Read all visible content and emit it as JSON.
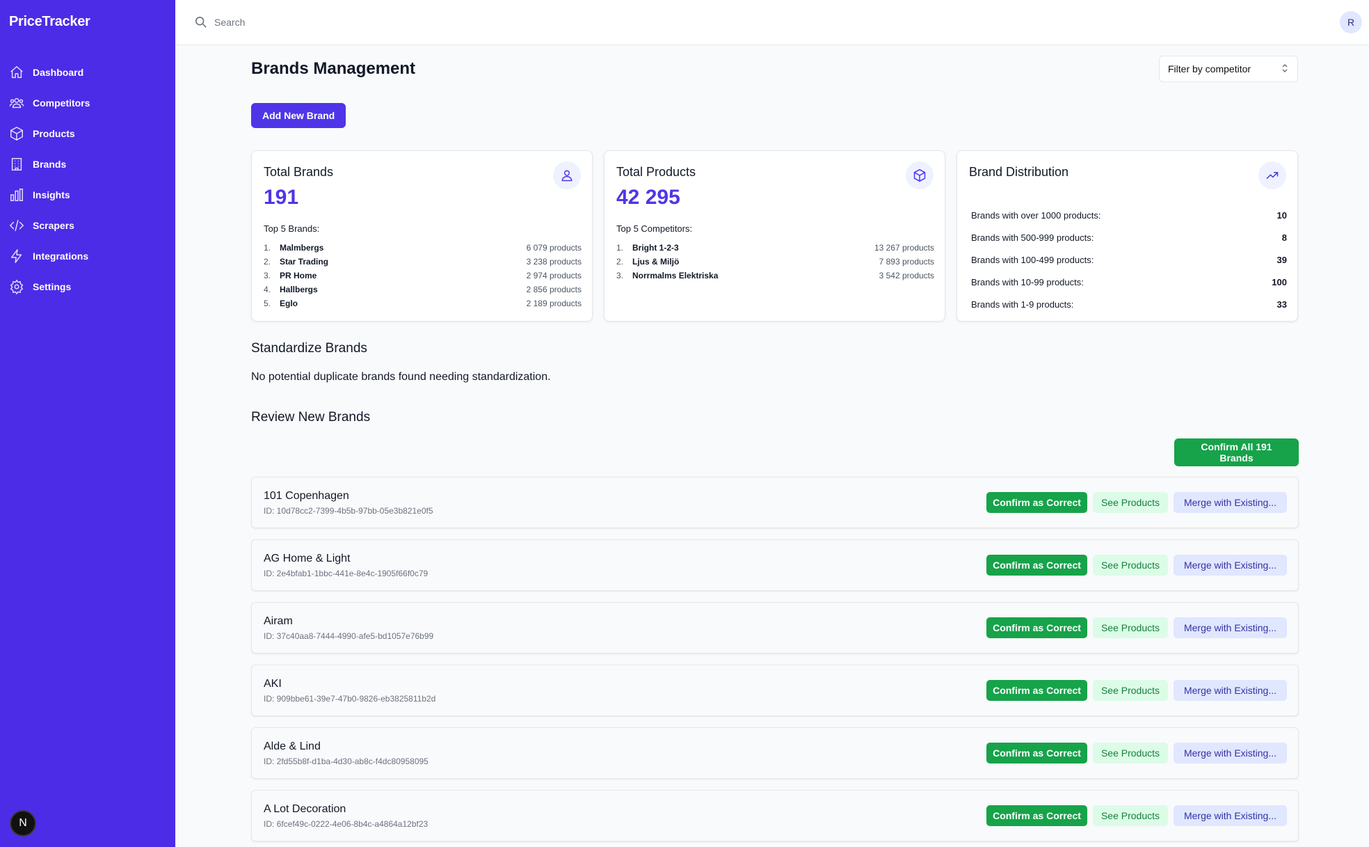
{
  "app": {
    "name": "PriceTracker"
  },
  "sidebar": {
    "items": [
      {
        "label": "Dashboard",
        "icon": "home-icon"
      },
      {
        "label": "Competitors",
        "icon": "users-icon"
      },
      {
        "label": "Products",
        "icon": "box-icon"
      },
      {
        "label": "Brands",
        "icon": "building-icon"
      },
      {
        "label": "Insights",
        "icon": "bar-chart-icon"
      },
      {
        "label": "Scrapers",
        "icon": "code-icon"
      },
      {
        "label": "Integrations",
        "icon": "lightning-icon"
      },
      {
        "label": "Settings",
        "icon": "gear-icon"
      }
    ],
    "footer_badge": "N"
  },
  "topbar": {
    "search_placeholder": "Search",
    "avatar": "R"
  },
  "page": {
    "title": "Brands Management",
    "filter_label": "Filter by competitor",
    "add_button": "Add New Brand"
  },
  "cards": {
    "brands": {
      "title": "Total Brands",
      "value": "191",
      "subtitle": "Top 5 Brands:",
      "items": [
        {
          "idx": "1.",
          "name": "Malmbergs",
          "count": "6 079 products"
        },
        {
          "idx": "2.",
          "name": "Star Trading",
          "count": "3 238 products"
        },
        {
          "idx": "3.",
          "name": "PR Home",
          "count": "2 974 products"
        },
        {
          "idx": "4.",
          "name": "Hallbergs",
          "count": "2 856 products"
        },
        {
          "idx": "5.",
          "name": "Eglo",
          "count": "2 189 products"
        }
      ]
    },
    "products": {
      "title": "Total Products",
      "value": "42 295",
      "subtitle": "Top 5 Competitors:",
      "items": [
        {
          "idx": "1.",
          "name": "Bright 1-2-3",
          "count": "13 267 products"
        },
        {
          "idx": "2.",
          "name": "Ljus & Miljö",
          "count": "7 893 products"
        },
        {
          "idx": "3.",
          "name": "Norrmalms Elektriska",
          "count": "3 542 products"
        }
      ]
    },
    "distribution": {
      "title": "Brand Distribution",
      "items": [
        {
          "label": "Brands with over 1000 products:",
          "value": "10"
        },
        {
          "label": "Brands with 500-999 products:",
          "value": "8"
        },
        {
          "label": "Brands with 100-499 products:",
          "value": "39"
        },
        {
          "label": "Brands with 10-99 products:",
          "value": "100"
        },
        {
          "label": "Brands with 1-9 products:",
          "value": "33"
        }
      ]
    }
  },
  "standardize": {
    "title": "Standardize Brands",
    "message": "No potential duplicate brands found needing standardization."
  },
  "review": {
    "title": "Review New Brands",
    "confirm_all": "Confirm All 191 Brands",
    "confirm_label": "Confirm as Correct",
    "see_label": "See Products",
    "merge_label": "Merge with Existing...",
    "brands": [
      {
        "name": "101 Copenhagen",
        "id": "ID: 10d78cc2-7399-4b5b-97bb-05e3b821e0f5"
      },
      {
        "name": "AG Home & Light",
        "id": "ID: 2e4bfab1-1bbc-441e-8e4c-1905f66f0c79"
      },
      {
        "name": "Airam",
        "id": "ID: 37c40aa8-7444-4990-afe5-bd1057e76b99"
      },
      {
        "name": "AKI",
        "id": "ID: 909bbe61-39e7-47b0-9826-eb3825811b2d"
      },
      {
        "name": "Alde & Lind",
        "id": "ID: 2fd55b8f-d1ba-4d30-ab8c-f4dc80958095"
      },
      {
        "name": "A Lot Decoration",
        "id": "ID: 6fcef49c-0222-4e06-8b4c-a4864a12bf23"
      }
    ]
  },
  "colors": {
    "sidebar": "#4c2ce6",
    "accent": "#4f35e8",
    "success": "#16a34a"
  }
}
